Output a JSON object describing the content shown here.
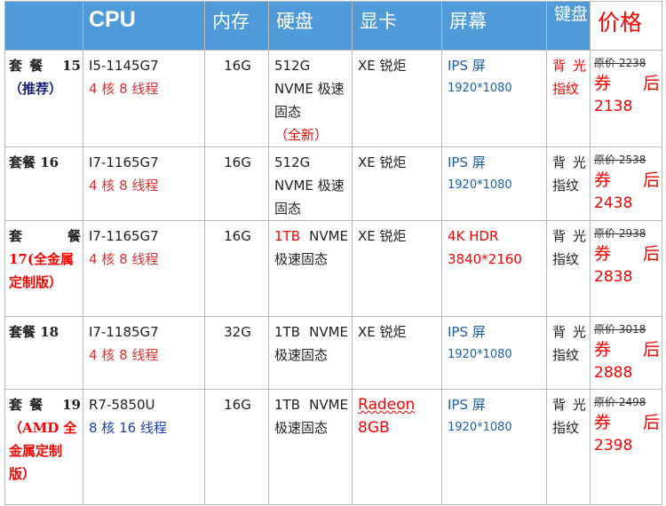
{
  "headers": {
    "package": "",
    "cpu": "CPU",
    "ram": "内存",
    "storage": "硬盘",
    "gpu": "显卡",
    "screen": "屏幕",
    "keyboard": "键盘",
    "price": "价格"
  },
  "rows": [
    {
      "package": "套餐 15",
      "package_sub": "（推荐）",
      "cpu": "I5-1145G7",
      "cores": "4 核 8 线程",
      "ram": "16G",
      "storage_line1": "512G",
      "storage_line2": "NVME 极速",
      "storage_line3": "固态",
      "storage_note": "（全新）",
      "gpu": "XE 锐炬",
      "screen_type": "IPS 屏",
      "screen_res": "1920*1080",
      "keyboard": "背光指纹",
      "orig_price": "原价 2238",
      "coupon": "券后",
      "final_price": "2138"
    },
    {
      "package": "套餐 16",
      "cpu": "I7-1165G7",
      "cores": "4 核 8 线程",
      "ram": "16G",
      "storage_line1": "512G",
      "storage_line2": "NVME 极速",
      "storage_line3": "固态",
      "gpu": "XE 锐炬",
      "screen_type": "IPS 屏",
      "screen_res": "1920*1080",
      "keyboard": "背光指纹",
      "orig_price": "原价 2538",
      "coupon": "券后",
      "final_price": "2438"
    },
    {
      "package": "套餐",
      "package_sub": "17(全金属定制版）",
      "cpu": "I7-1165G7",
      "cores": "4 核 8 线程",
      "ram": "16G",
      "storage_tb": "1TB",
      "storage_line2": "NVME",
      "storage_line3": "极速固态",
      "gpu": "XE 锐炬",
      "screen_type": "4K HDR",
      "screen_res": "3840*2160",
      "keyboard": "背光指纹",
      "orig_price": "原价 2938",
      "coupon": "券后",
      "final_price": "2838"
    },
    {
      "package": "套餐 18",
      "cpu": "I7-1185G7",
      "cores": "4 核 8 线程",
      "ram": "32G",
      "storage_tb": "1TB",
      "storage_line2": "NVME",
      "storage_line3": "极速固态",
      "gpu": "XE 锐炬",
      "screen_type": "IPS 屏",
      "screen_res": "1920*1080",
      "keyboard": "背光指纹",
      "orig_price": "原价 3018",
      "coupon": "券后",
      "final_price": "2888"
    },
    {
      "package": "套餐 19",
      "package_sub": "（AMD 全金属定制版）",
      "cpu": "R7-5850U",
      "cores": "8 核 16 线程",
      "ram": "16G",
      "storage_tb": "1TB",
      "storage_line2": "NVME",
      "storage_line3": "极速固态",
      "gpu": "Radeon",
      "gpu_mem": "8GB",
      "screen_type": "IPS 屏",
      "screen_res": "1920*1080",
      "keyboard": "背光指纹",
      "orig_price": "原价 2498",
      "coupon": "券后",
      "final_price": "2398"
    }
  ]
}
